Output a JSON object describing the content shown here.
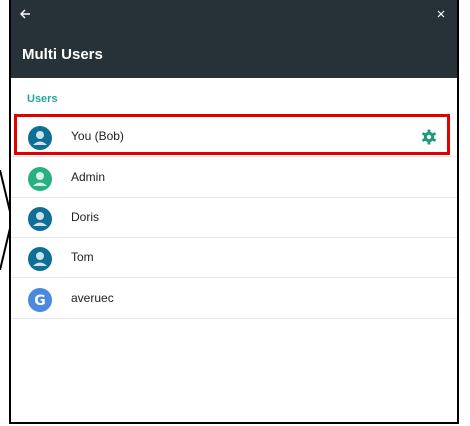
{
  "header": {
    "title": "Multi Users"
  },
  "section": {
    "label": "Users"
  },
  "users": [
    {
      "name": "You (Bob)",
      "avatar": "person-icon",
      "color": "#0d6f96",
      "has_settings": true
    },
    {
      "name": "Admin",
      "avatar": "person-icon",
      "color": "#26b083"
    },
    {
      "name": "Doris",
      "avatar": "person-icon",
      "color": "#0d6f96"
    },
    {
      "name": "Tom",
      "avatar": "person-icon",
      "color": "#0d6f96"
    },
    {
      "name": "averuec",
      "avatar": "google-icon",
      "color": "#4a89dc"
    }
  ],
  "colors": {
    "topbar": "#263238",
    "accent": "#26a69a",
    "highlight": "#e00000"
  },
  "icons": {
    "back": "back-arrow-icon",
    "close": "close-icon",
    "settings": "gear-icon"
  }
}
